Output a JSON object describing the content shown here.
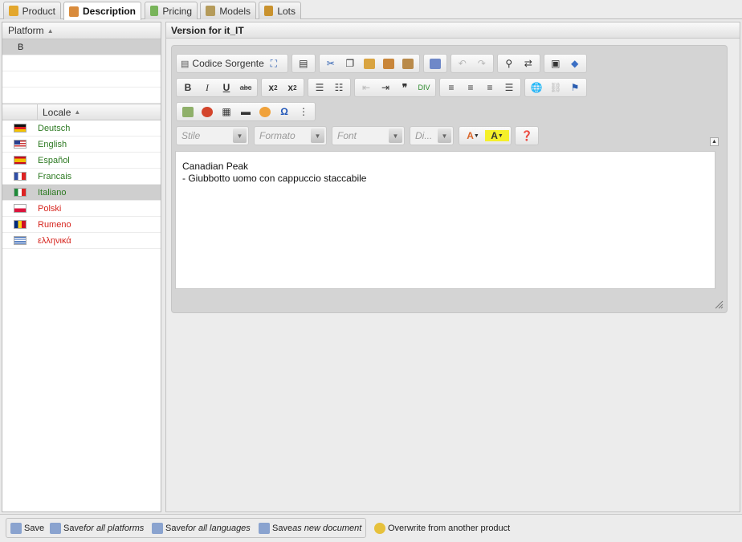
{
  "tabs": [
    {
      "label": "Product",
      "icon": "product-box-icon",
      "color": "#e3a72d"
    },
    {
      "label": "Description",
      "icon": "users-icon",
      "color": "#d98b3b"
    },
    {
      "label": "Pricing",
      "icon": "money-icon",
      "color": "#78b45a"
    },
    {
      "label": "Models",
      "icon": "models-icon",
      "color": "#b59b5a"
    },
    {
      "label": "Lots",
      "icon": "folder-icon",
      "color": "#c9922e"
    }
  ],
  "platforms": {
    "header": "Platform",
    "rows": [
      "B"
    ]
  },
  "locales": {
    "header": "Locale",
    "rows": [
      {
        "label": "Deutsch",
        "color": "green"
      },
      {
        "label": "English",
        "color": "green"
      },
      {
        "label": "Español",
        "color": "green"
      },
      {
        "label": "Francais",
        "color": "green"
      },
      {
        "label": "Italiano",
        "color": "green"
      },
      {
        "label": "Polski",
        "color": "red"
      },
      {
        "label": "Rumeno",
        "color": "red"
      },
      {
        "label": "ελληνικά",
        "color": "red"
      }
    ]
  },
  "editor": {
    "title": "Version for it_IT",
    "source_label": "Codice Sorgente",
    "combos": {
      "style": "Stile",
      "format": "Formato",
      "font": "Font",
      "size": "Di..."
    },
    "content_line1": "Canadian Peak",
    "content_line2": "- Giubbotto uomo con cappuccio staccabile"
  },
  "footer": {
    "save": "Save",
    "save_platforms_prefix": "Save ",
    "save_platforms_em": "for all platforms",
    "save_languages_prefix": "Save ",
    "save_languages_em": "for all languages",
    "save_new_prefix": "Save ",
    "save_new_em": "as new document",
    "overwrite": "Overwrite from another product"
  }
}
